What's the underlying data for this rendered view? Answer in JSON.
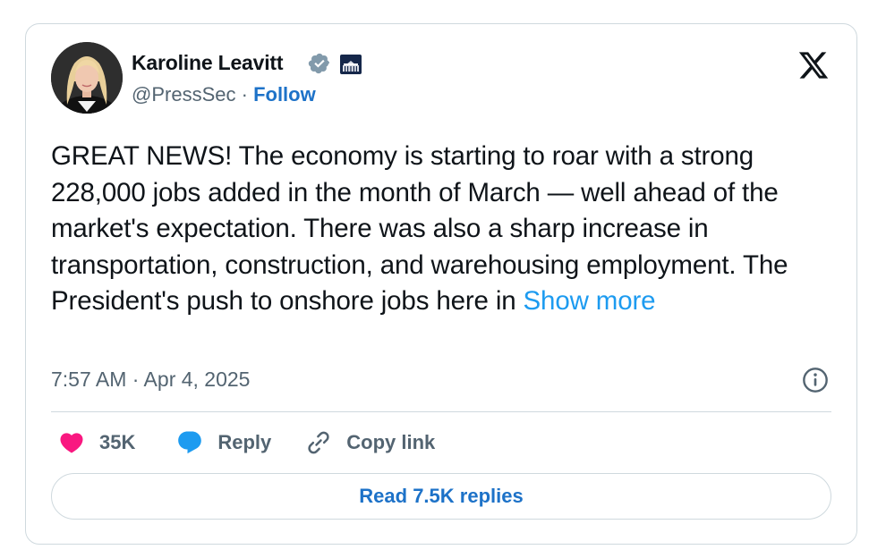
{
  "author": {
    "name": "Karoline Leavitt",
    "handle": "@PressSec",
    "separator": "·",
    "follow_label": "Follow"
  },
  "tweet": {
    "text": "GREAT NEWS! The economy is starting to roar with a strong 228,000 jobs added in the month of March — well ahead of the market's expectation. There was also a sharp increase in transportation, construction, and warehousing employment. The President's push to onshore jobs here in",
    "show_more_label": "Show more",
    "timestamp": "7:57 AM · Apr 4, 2025"
  },
  "actions": {
    "likes": "35K",
    "reply_label": "Reply",
    "copy_link_label": "Copy link"
  },
  "read_replies_label": "Read 7.5K replies",
  "colors": {
    "link": "#1d72c8",
    "show_more": "#1d9bf0",
    "like": "#f91880",
    "reply_icon": "#1d9bf0",
    "secondary_text": "#536471",
    "border": "#cfd9de"
  },
  "icons": [
    "x-logo-icon",
    "verified-badge-icon",
    "white-house-flag-icon",
    "info-icon",
    "heart-icon",
    "reply-bubble-icon",
    "link-icon"
  ]
}
